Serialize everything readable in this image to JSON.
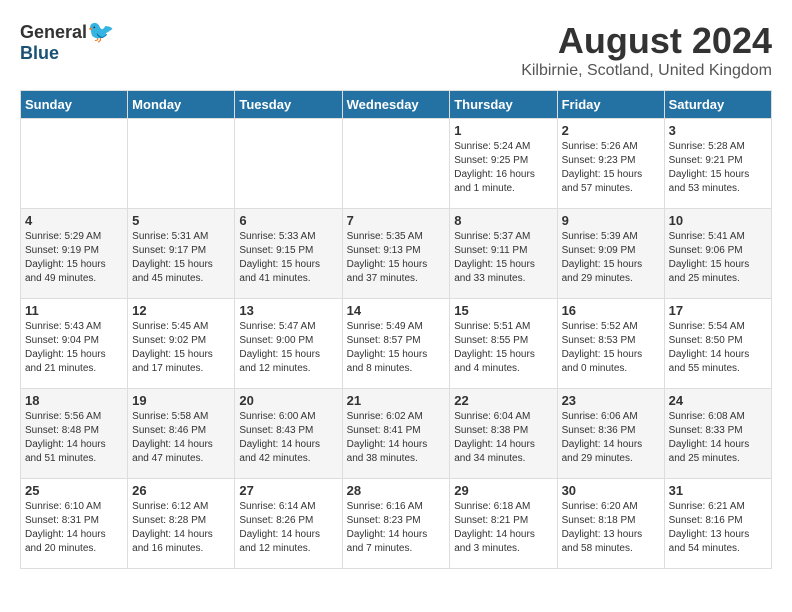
{
  "logo": {
    "general": "General",
    "blue": "Blue"
  },
  "title": "August 2024",
  "location": "Kilbirnie, Scotland, United Kingdom",
  "days_of_week": [
    "Sunday",
    "Monday",
    "Tuesday",
    "Wednesday",
    "Thursday",
    "Friday",
    "Saturday"
  ],
  "weeks": [
    [
      {
        "day": "",
        "detail": ""
      },
      {
        "day": "",
        "detail": ""
      },
      {
        "day": "",
        "detail": ""
      },
      {
        "day": "",
        "detail": ""
      },
      {
        "day": "1",
        "detail": "Sunrise: 5:24 AM\nSunset: 9:25 PM\nDaylight: 16 hours and 1 minute."
      },
      {
        "day": "2",
        "detail": "Sunrise: 5:26 AM\nSunset: 9:23 PM\nDaylight: 15 hours and 57 minutes."
      },
      {
        "day": "3",
        "detail": "Sunrise: 5:28 AM\nSunset: 9:21 PM\nDaylight: 15 hours and 53 minutes."
      }
    ],
    [
      {
        "day": "4",
        "detail": "Sunrise: 5:29 AM\nSunset: 9:19 PM\nDaylight: 15 hours and 49 minutes."
      },
      {
        "day": "5",
        "detail": "Sunrise: 5:31 AM\nSunset: 9:17 PM\nDaylight: 15 hours and 45 minutes."
      },
      {
        "day": "6",
        "detail": "Sunrise: 5:33 AM\nSunset: 9:15 PM\nDaylight: 15 hours and 41 minutes."
      },
      {
        "day": "7",
        "detail": "Sunrise: 5:35 AM\nSunset: 9:13 PM\nDaylight: 15 hours and 37 minutes."
      },
      {
        "day": "8",
        "detail": "Sunrise: 5:37 AM\nSunset: 9:11 PM\nDaylight: 15 hours and 33 minutes."
      },
      {
        "day": "9",
        "detail": "Sunrise: 5:39 AM\nSunset: 9:09 PM\nDaylight: 15 hours and 29 minutes."
      },
      {
        "day": "10",
        "detail": "Sunrise: 5:41 AM\nSunset: 9:06 PM\nDaylight: 15 hours and 25 minutes."
      }
    ],
    [
      {
        "day": "11",
        "detail": "Sunrise: 5:43 AM\nSunset: 9:04 PM\nDaylight: 15 hours and 21 minutes."
      },
      {
        "day": "12",
        "detail": "Sunrise: 5:45 AM\nSunset: 9:02 PM\nDaylight: 15 hours and 17 minutes."
      },
      {
        "day": "13",
        "detail": "Sunrise: 5:47 AM\nSunset: 9:00 PM\nDaylight: 15 hours and 12 minutes."
      },
      {
        "day": "14",
        "detail": "Sunrise: 5:49 AM\nSunset: 8:57 PM\nDaylight: 15 hours and 8 minutes."
      },
      {
        "day": "15",
        "detail": "Sunrise: 5:51 AM\nSunset: 8:55 PM\nDaylight: 15 hours and 4 minutes."
      },
      {
        "day": "16",
        "detail": "Sunrise: 5:52 AM\nSunset: 8:53 PM\nDaylight: 15 hours and 0 minutes."
      },
      {
        "day": "17",
        "detail": "Sunrise: 5:54 AM\nSunset: 8:50 PM\nDaylight: 14 hours and 55 minutes."
      }
    ],
    [
      {
        "day": "18",
        "detail": "Sunrise: 5:56 AM\nSunset: 8:48 PM\nDaylight: 14 hours and 51 minutes."
      },
      {
        "day": "19",
        "detail": "Sunrise: 5:58 AM\nSunset: 8:46 PM\nDaylight: 14 hours and 47 minutes."
      },
      {
        "day": "20",
        "detail": "Sunrise: 6:00 AM\nSunset: 8:43 PM\nDaylight: 14 hours and 42 minutes."
      },
      {
        "day": "21",
        "detail": "Sunrise: 6:02 AM\nSunset: 8:41 PM\nDaylight: 14 hours and 38 minutes."
      },
      {
        "day": "22",
        "detail": "Sunrise: 6:04 AM\nSunset: 8:38 PM\nDaylight: 14 hours and 34 minutes."
      },
      {
        "day": "23",
        "detail": "Sunrise: 6:06 AM\nSunset: 8:36 PM\nDaylight: 14 hours and 29 minutes."
      },
      {
        "day": "24",
        "detail": "Sunrise: 6:08 AM\nSunset: 8:33 PM\nDaylight: 14 hours and 25 minutes."
      }
    ],
    [
      {
        "day": "25",
        "detail": "Sunrise: 6:10 AM\nSunset: 8:31 PM\nDaylight: 14 hours and 20 minutes."
      },
      {
        "day": "26",
        "detail": "Sunrise: 6:12 AM\nSunset: 8:28 PM\nDaylight: 14 hours and 16 minutes."
      },
      {
        "day": "27",
        "detail": "Sunrise: 6:14 AM\nSunset: 8:26 PM\nDaylight: 14 hours and 12 minutes."
      },
      {
        "day": "28",
        "detail": "Sunrise: 6:16 AM\nSunset: 8:23 PM\nDaylight: 14 hours and 7 minutes."
      },
      {
        "day": "29",
        "detail": "Sunrise: 6:18 AM\nSunset: 8:21 PM\nDaylight: 14 hours and 3 minutes."
      },
      {
        "day": "30",
        "detail": "Sunrise: 6:20 AM\nSunset: 8:18 PM\nDaylight: 13 hours and 58 minutes."
      },
      {
        "day": "31",
        "detail": "Sunrise: 6:21 AM\nSunset: 8:16 PM\nDaylight: 13 hours and 54 minutes."
      }
    ]
  ]
}
